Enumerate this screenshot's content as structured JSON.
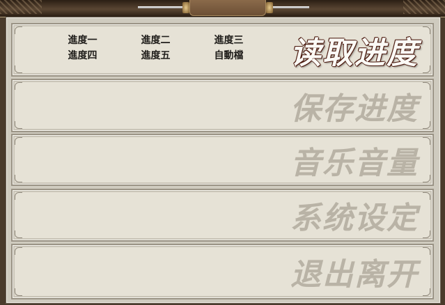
{
  "menu": [
    {
      "key": "load",
      "title": "读取进度",
      "active": true,
      "slots": [
        "進度一",
        "進度二",
        "進度三",
        "進度四",
        "進度五",
        "自動檔"
      ]
    },
    {
      "key": "save",
      "title": "保存进度",
      "active": false
    },
    {
      "key": "music",
      "title": "音乐音量",
      "active": false
    },
    {
      "key": "system",
      "title": "系统设定",
      "active": false
    },
    {
      "key": "exit",
      "title": "退出离开",
      "active": false
    }
  ]
}
